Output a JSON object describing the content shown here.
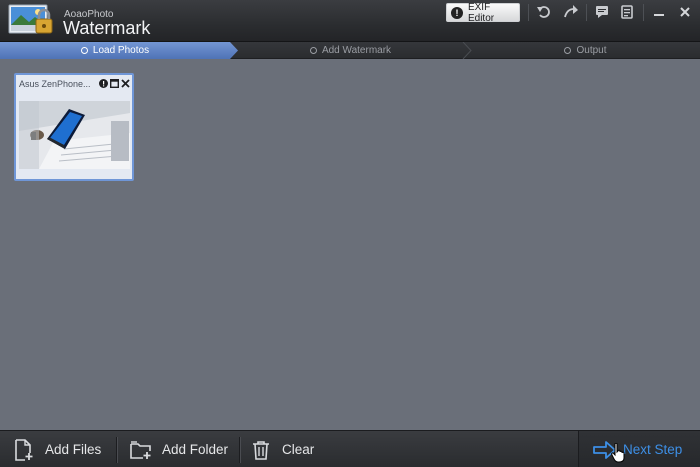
{
  "app": {
    "brand": "AoaoPhoto",
    "title": "Watermark"
  },
  "toolbar": {
    "exif_label": "EXIF Editor",
    "icons": [
      "exif-alert-icon",
      "undo-icon",
      "redo-icon",
      "feedback-icon",
      "notes-icon",
      "minimize-icon",
      "close-icon"
    ]
  },
  "steps": [
    {
      "label": "Load Photos",
      "active": true
    },
    {
      "label": "Add Watermark",
      "active": false
    },
    {
      "label": "Output",
      "active": false
    }
  ],
  "photos": [
    {
      "name": "Asus ZenPhone..."
    }
  ],
  "bottom": {
    "add_files": "Add Files",
    "add_folder": "Add Folder",
    "clear": "Clear",
    "next_step": "Next Step"
  },
  "colors": {
    "accent": "#3d8fe6",
    "active_step": "#5b7fc2",
    "card_border": "#6f96d7",
    "workspace": "#6a6f79"
  }
}
